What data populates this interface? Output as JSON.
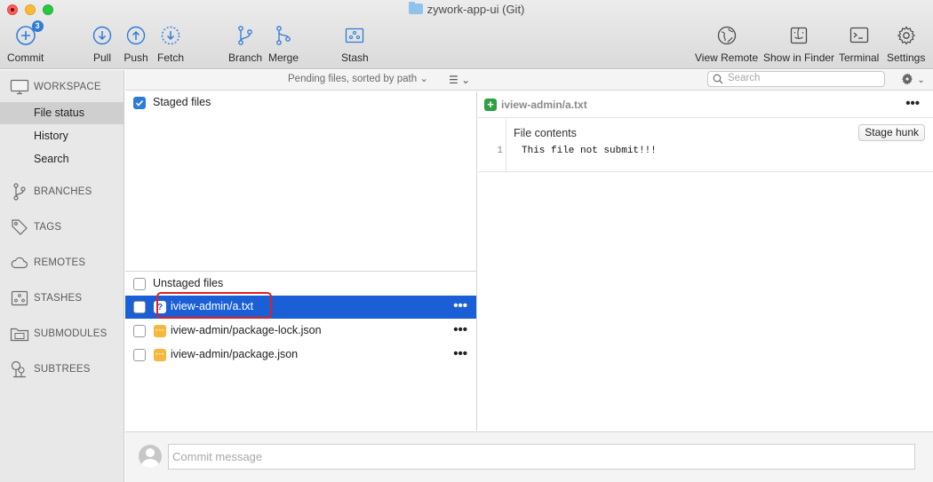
{
  "window": {
    "title": "zywork-app-ui (Git)"
  },
  "toolbar": {
    "commit": {
      "label": "Commit",
      "badge": "3"
    },
    "pull": "Pull",
    "push": "Push",
    "fetch": "Fetch",
    "branch": "Branch",
    "merge": "Merge",
    "stash": "Stash",
    "view_remote": "View Remote",
    "show_in_finder": "Show in Finder",
    "terminal": "Terminal",
    "settings": "Settings"
  },
  "sidebar": {
    "workspace": "WORKSPACE",
    "items": [
      "File status",
      "History",
      "Search"
    ],
    "selected": "File status",
    "groups": [
      "BRANCHES",
      "TAGS",
      "REMOTES",
      "STASHES",
      "SUBMODULES",
      "SUBTREES"
    ]
  },
  "file_pane": {
    "sort_label": "Pending files, sorted by path",
    "search_placeholder": "Search",
    "staged_label": "Staged files",
    "staged_checked": true,
    "unstaged_label": "Unstaged files",
    "unstaged_checked": false,
    "unstaged": [
      {
        "path": "iview-admin/a.txt",
        "status": "?",
        "selected": true
      },
      {
        "path": "iview-admin/package-lock.json",
        "status": "···",
        "selected": false
      },
      {
        "path": "iview-admin/package.json",
        "status": "···",
        "selected": false
      }
    ],
    "more_icon": "•••"
  },
  "diff": {
    "path": "iview-admin/a.txt",
    "add_icon": "+",
    "hunk_title": "File contents",
    "stage_hunk": "Stage hunk",
    "lines": [
      {
        "no": "1",
        "text": "This file not submit!!!"
      }
    ]
  },
  "commit": {
    "placeholder": "Commit message"
  },
  "colors": {
    "selection": "#1a5fd6",
    "accent": "#2f7bd8",
    "modified": "#f6b73c",
    "added": "#2ea043",
    "highlight": "#e02020"
  }
}
